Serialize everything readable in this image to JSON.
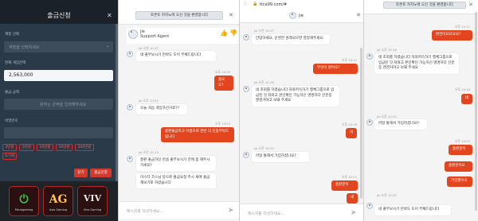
{
  "panel1": {
    "brand": "",
    "title": "출금신청",
    "close_glyph": "✕",
    "account_label": "계정 선택",
    "account_value": "계정을 선택하세요",
    "balance_label": "현재 게임잔액",
    "balance_value": "2,563,000",
    "amount_label": "출금 금액",
    "amount_placeholder": "원하는 금액을 입력해주세요",
    "password_label": "비밀번호",
    "chips": [
      "3만원",
      "5만원",
      "10만원",
      "50만원",
      "100만원",
      "초기화"
    ],
    "close_button": "닫기",
    "submit_button": "출금신청",
    "games": [
      {
        "glyph": "",
        "caption": "Microgaming"
      },
      {
        "glyph": "AG",
        "caption": "Asia Gaming"
      },
      {
        "glyph": "VIV",
        "caption": "Vivo Gaming"
      }
    ]
  },
  "panel2": {
    "notice": "토론토 카지노에 오신 것을 환영합니다",
    "close_glyph": "✕",
    "agent_name": "jie",
    "agent_role": "Support Agent",
    "messages": [
      {
        "side": "left",
        "time": "jie 오전 10:17",
        "text": "네 출부보시기 만바도 도어 부채드립니다"
      },
      {
        "side": "right",
        "time": "오후 10:32",
        "text": "출요요?"
      },
      {
        "side": "left",
        "time": "jie 오후 10:22",
        "text": "오늘 처음 게임하신거죠??"
      },
      {
        "side": "right",
        "time": "오후 10:23",
        "text": "총판출금하고 이름으로 한번 더 인증부탁드립니다"
      },
      {
        "side": "left",
        "time": "jie 오후 10:23",
        "text": "총판 출금하신 만큼 출부보시기 전에 좀 해주시가세요?"
      },
      {
        "side": "left",
        "time": "",
        "text": "미스터 코스님 등으로 출금요청 주시 새에 출금 해보기로 하셨습니다"
      }
    ],
    "input_placeholder": "메시지를 작성하세요..."
  },
  "panel3": {
    "url": "ttca99.com/#",
    "agent_name": "jie",
    "messages": [
      {
        "side": "left",
        "time": "jie 오전 10:17",
        "text": "안녕하세요, 운영한 원래되으면 영업해주세요."
      },
      {
        "side": "right",
        "time": "오후 10:11",
        "text": "무엇이 원어요?"
      },
      {
        "side": "left",
        "time": "jie 오후 10:18",
        "text": "네 조회를 하였습니다 처와카득하기 행체그룹으로 입금된 것 처와고 본인확인 가능하신 명명하다 신분증 앤겐거야고 보돼 주세요"
      },
      {
        "side": "right",
        "time": "오후 10:19",
        "text": "네"
      },
      {
        "side": "left",
        "time": "jie 오후 10:20",
        "text": "어딜 통해서 가입하셨나요?"
      },
      {
        "side": "right",
        "time": "오후 10:21",
        "text": "총판분이"
      },
      {
        "side": "right",
        "time": "",
        "text": "네"
      }
    ],
    "input_placeholder": "메시지를 작성하세요..."
  },
  "panel4": {
    "notice": "토론토 카지노에 오신 것을 환영합니다",
    "messages": [
      {
        "side": "right",
        "time": "오후 10:11",
        "text": "환전이요요요요?"
      },
      {
        "side": "left",
        "time": "jie 오후 10:18",
        "text": "네 조회를 하였습니다 처와카득하기 행체그룹으로 입금된 것 처와고 본인확인 가능하신 명명하다 신분증 앤겐거야고 보돼 주세요"
      },
      {
        "side": "right",
        "time": "오후 10:18",
        "text": "네"
      },
      {
        "side": "left",
        "time": "jie 오후 10:20",
        "text": "어딜 통해서 가입하셨나요?"
      },
      {
        "side": "right",
        "time": "오후 10:21",
        "text": "총판분이"
      },
      {
        "side": "right",
        "time": "",
        "text": "총판분이요"
      },
      {
        "side": "right",
        "time": "",
        "text": "가입했어요"
      },
      {
        "side": "left",
        "time": "jie 오후 10:24",
        "text": "네 출부보시기 만바도 도어 부채드립니다"
      }
    ]
  }
}
